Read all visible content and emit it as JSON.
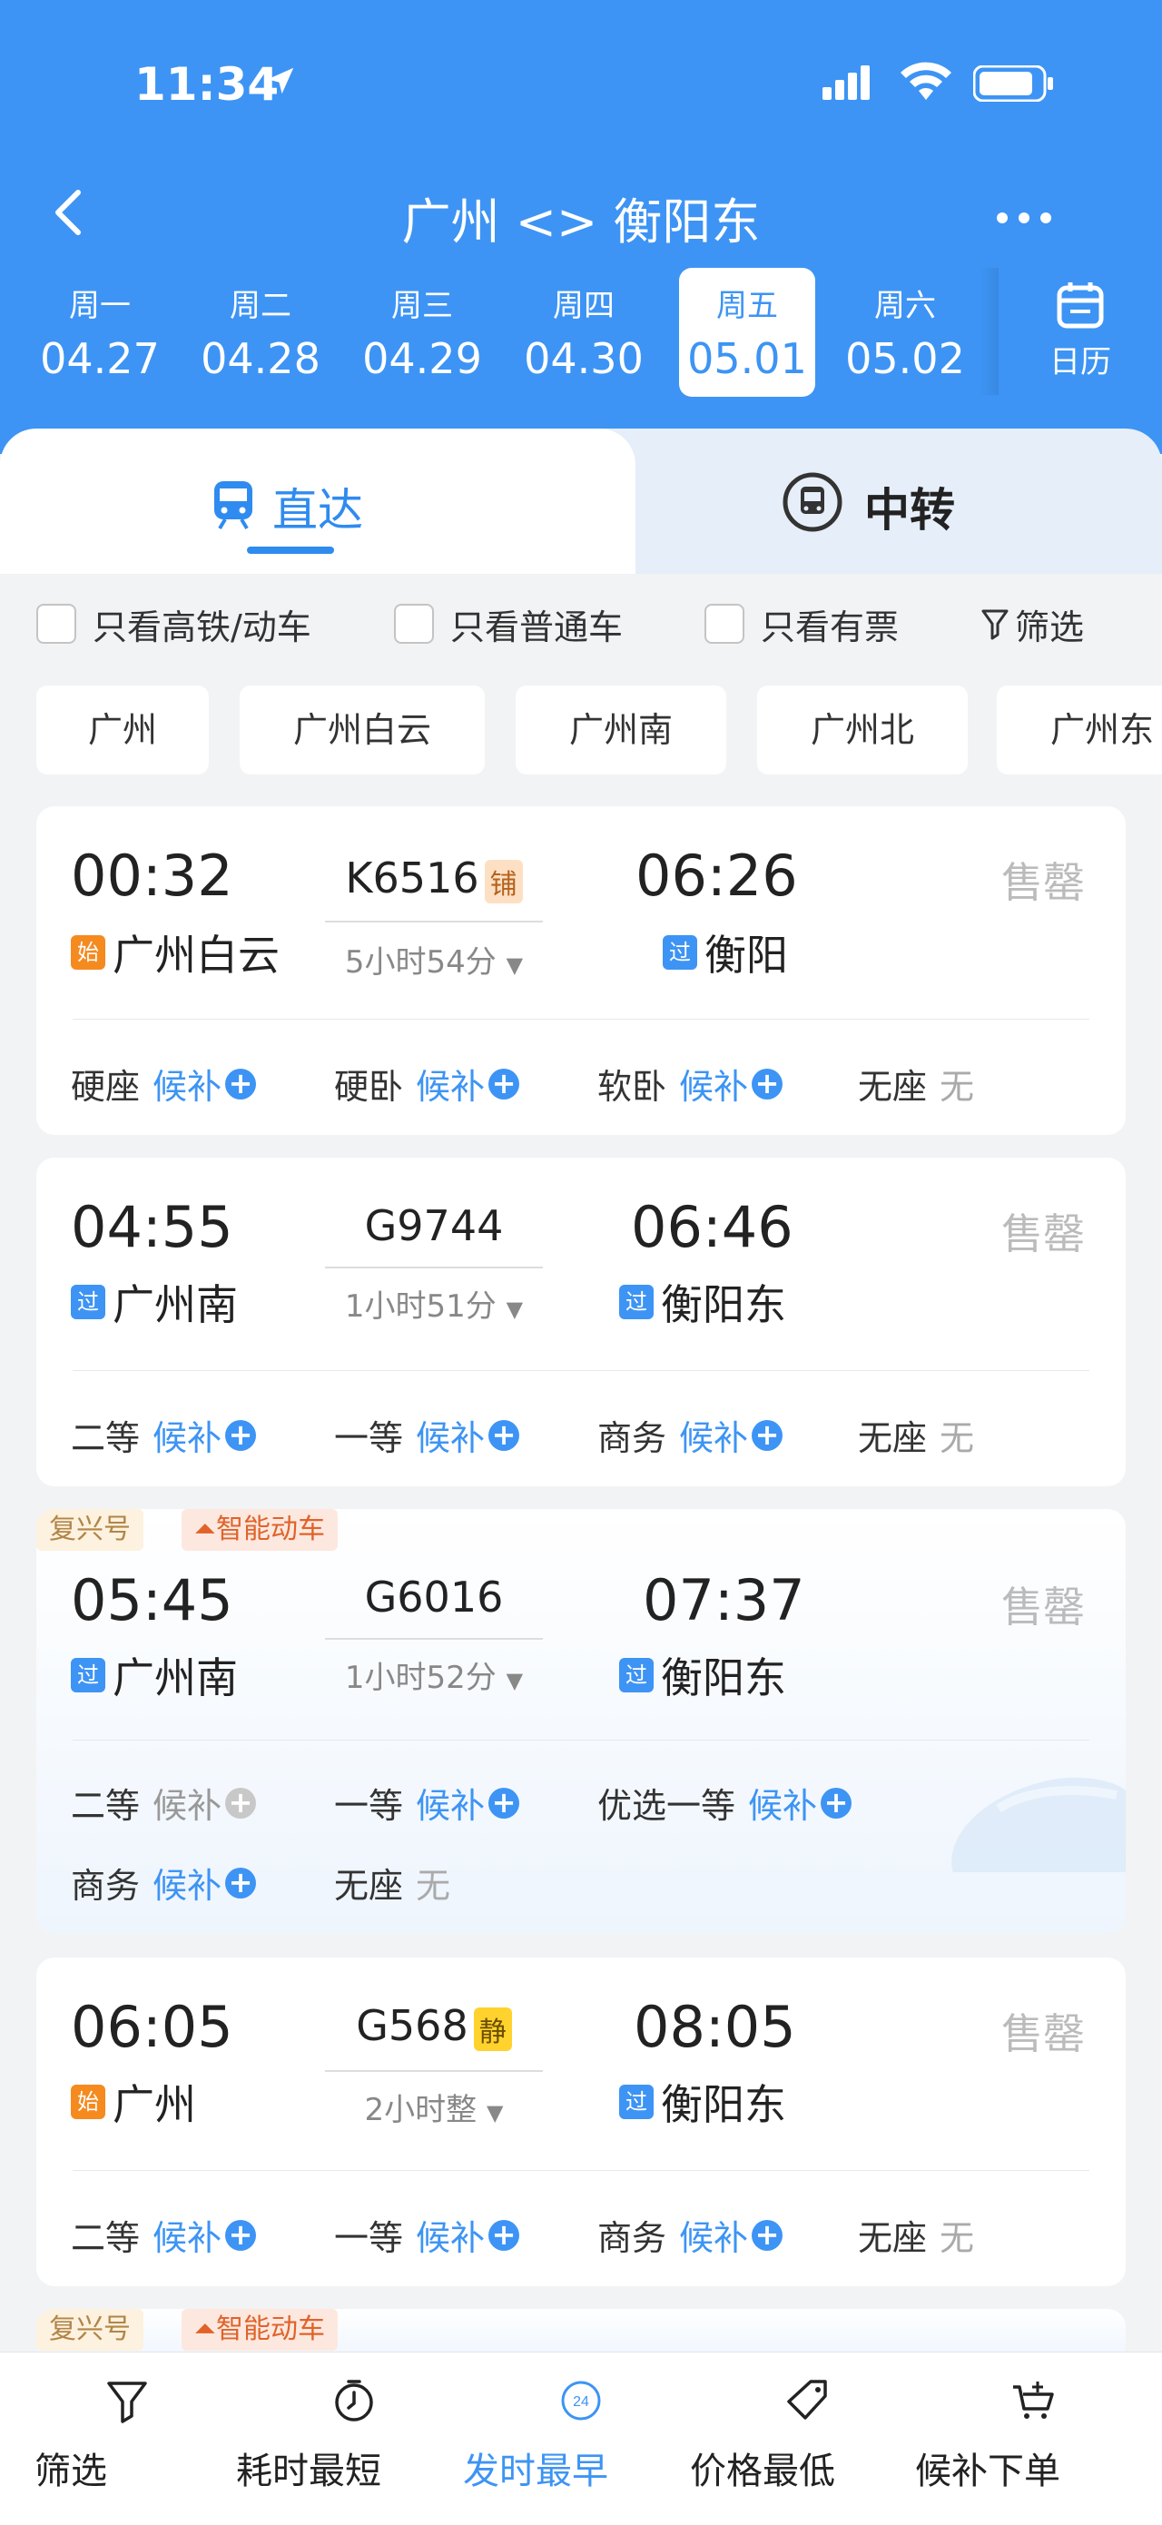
{
  "status": {
    "time": "11:34"
  },
  "header": {
    "title": "广州 <> 衡阳东"
  },
  "dates": [
    {
      "week": "周一",
      "date": "04.27"
    },
    {
      "week": "周二",
      "date": "04.28"
    },
    {
      "week": "周三",
      "date": "04.29"
    },
    {
      "week": "周四",
      "date": "04.30"
    },
    {
      "week": "周五",
      "date": "05.01",
      "selected": true
    },
    {
      "week": "周六",
      "date": "05.02"
    }
  ],
  "calendar_label": "日历",
  "tabs": {
    "direct": "直达",
    "transfer": "中转"
  },
  "filters": {
    "highspeed": "只看高铁/动车",
    "normal": "只看普通车",
    "available": "只看有票",
    "filter": "筛选"
  },
  "stations": [
    "广州",
    "广州白云",
    "广州南",
    "广州北",
    "广州东"
  ],
  "trains": [
    {
      "dep_time": "00:32",
      "dep_tag": "始",
      "dep_station": "广州白云",
      "number": "K6516",
      "badge": "铺",
      "duration": "5小时54分",
      "arr_time": "06:26",
      "arr_tag": "过",
      "arr_station": "衡阳",
      "status": "售罄",
      "seats": [
        {
          "name": "硬座",
          "state": "候补"
        },
        {
          "name": "硬卧",
          "state": "候补"
        },
        {
          "name": "软卧",
          "state": "候补"
        },
        {
          "name": "无座",
          "state": "无"
        }
      ]
    },
    {
      "dep_time": "04:55",
      "dep_tag": "过",
      "dep_station": "广州南",
      "number": "G9744",
      "duration": "1小时51分",
      "arr_time": "06:46",
      "arr_tag": "过",
      "arr_station": "衡阳东",
      "status": "售罄",
      "seats": [
        {
          "name": "二等",
          "state": "候补"
        },
        {
          "name": "一等",
          "state": "候补"
        },
        {
          "name": "商务",
          "state": "候补"
        },
        {
          "name": "无座",
          "state": "无"
        }
      ]
    },
    {
      "labels": [
        "复兴号",
        "智能动车"
      ],
      "dep_time": "05:45",
      "dep_tag": "过",
      "dep_station": "广州南",
      "number": "G6016",
      "duration": "1小时52分",
      "arr_time": "07:37",
      "arr_tag": "过",
      "arr_station": "衡阳东",
      "status": "售罄",
      "seats": [
        {
          "name": "二等",
          "state": "候补"
        },
        {
          "name": "一等",
          "state": "候补"
        },
        {
          "name": "优选一等",
          "state": "候补"
        },
        {
          "name": "商务",
          "state": "候补"
        },
        {
          "name": "无座",
          "state": "无"
        }
      ]
    },
    {
      "dep_time": "06:05",
      "dep_tag": "始",
      "dep_station": "广州",
      "number": "G568",
      "badge": "静",
      "duration": "2小时整",
      "arr_time": "08:05",
      "arr_tag": "过",
      "arr_station": "衡阳东",
      "status": "售罄",
      "seats": [
        {
          "name": "二等",
          "state": "候补"
        },
        {
          "name": "一等",
          "state": "候补"
        },
        {
          "name": "商务",
          "state": "候补"
        },
        {
          "name": "无座",
          "state": "无"
        }
      ]
    },
    {
      "labels": [
        "复兴号",
        "智能动车"
      ]
    }
  ],
  "bottom_bar": [
    {
      "label": "筛选",
      "icon": "filter-icon"
    },
    {
      "label": "耗时最短",
      "icon": "clock-icon"
    },
    {
      "label": "发时最早",
      "icon": "24h-icon",
      "active": true,
      "icon_text": "24"
    },
    {
      "label": "价格最低",
      "icon": "price-tag-icon"
    },
    {
      "label": "候补下单",
      "icon": "cart-plus-icon"
    }
  ],
  "colors": {
    "accent": "#3d94f4",
    "start_tag": "#f58a1f",
    "sold": "#bbbbbb"
  }
}
